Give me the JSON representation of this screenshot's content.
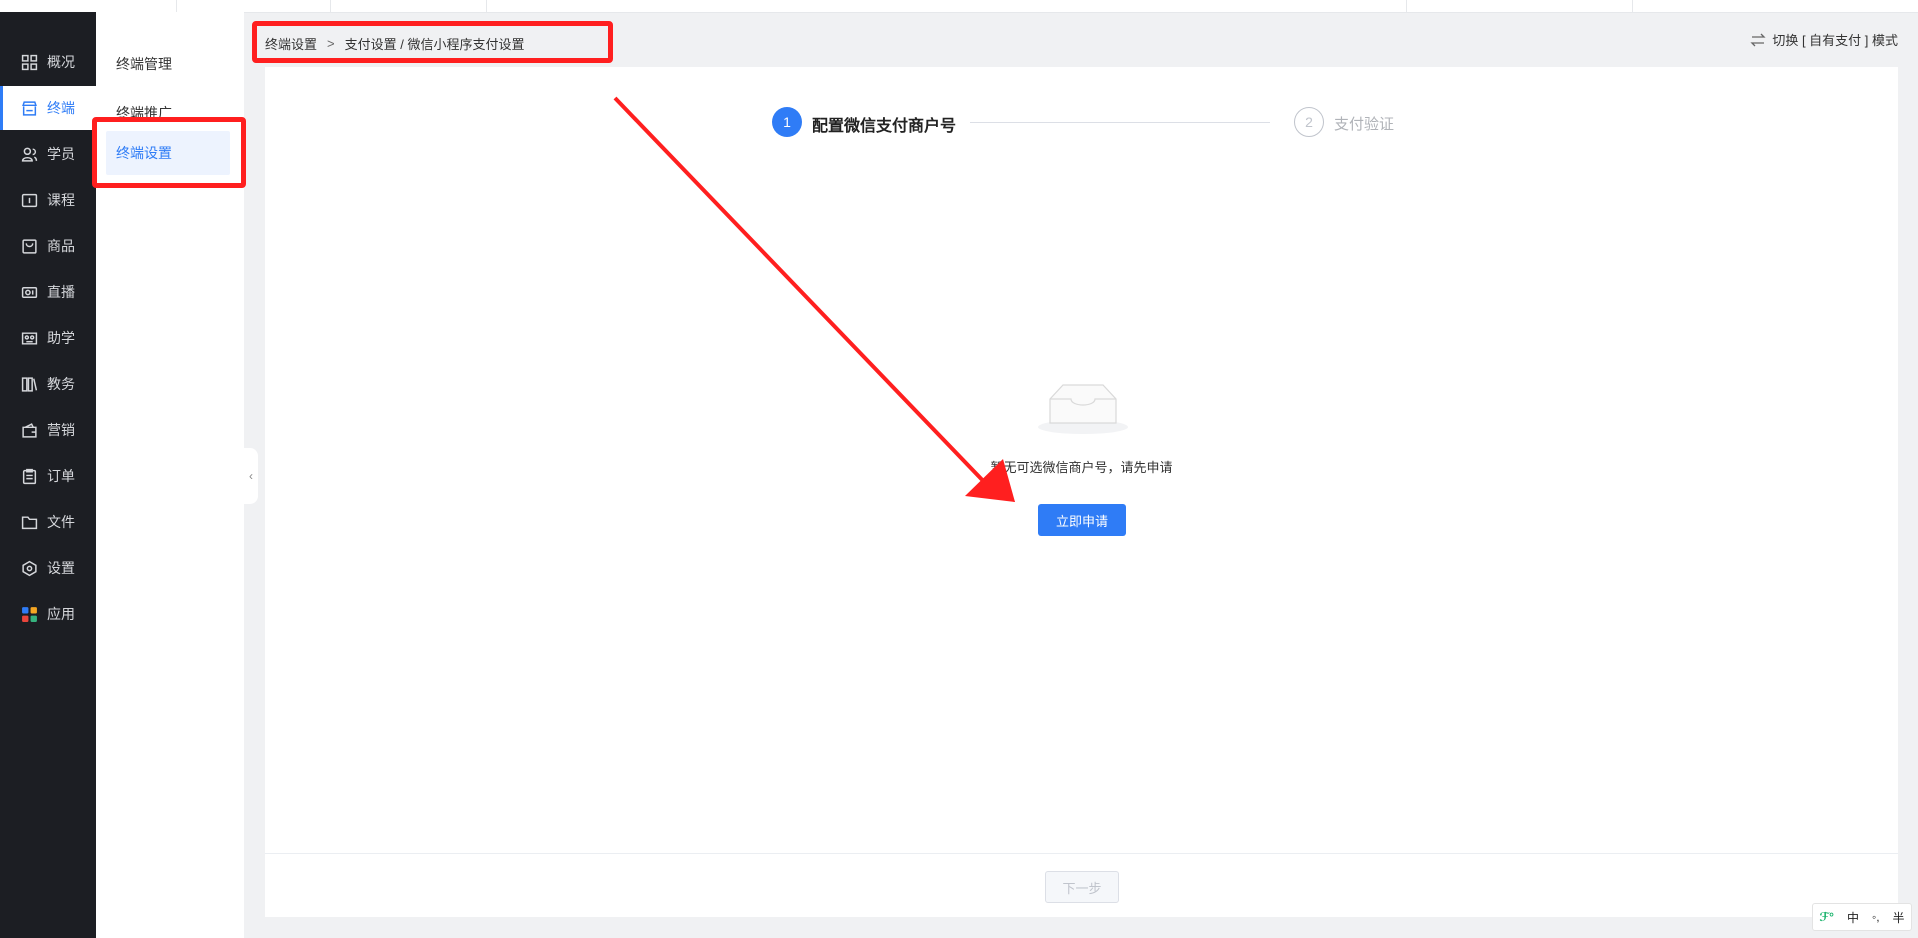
{
  "sidebar": {
    "items": [
      {
        "label": "概况",
        "icon": "grid-icon"
      },
      {
        "label": "终端",
        "icon": "store-icon"
      },
      {
        "label": "学员",
        "icon": "users-icon"
      },
      {
        "label": "课程",
        "icon": "course-icon"
      },
      {
        "label": "商品",
        "icon": "bag-icon"
      },
      {
        "label": "直播",
        "icon": "video-camera-icon"
      },
      {
        "label": "助学",
        "icon": "study-icon"
      },
      {
        "label": "教务",
        "icon": "books-icon"
      },
      {
        "label": "营销",
        "icon": "wallet-icon"
      },
      {
        "label": "订单",
        "icon": "clipboard-icon"
      },
      {
        "label": "文件",
        "icon": "folder-icon"
      },
      {
        "label": "设置",
        "icon": "hexagon-settings-icon"
      },
      {
        "label": "应用",
        "icon": "apps-icon"
      }
    ],
    "active_index": 1
  },
  "submenu": {
    "items": [
      {
        "label": "终端管理"
      },
      {
        "label": "终端推广"
      },
      {
        "label": "终端设置"
      }
    ],
    "active_index": 2
  },
  "breadcrumb": {
    "first": "终端设置",
    "separator": ">",
    "second": "支付设置 / 微信小程序支付设置"
  },
  "mode_switch": {
    "label": "切换 [ 自有支付 ] 模式",
    "icon": "swap-arrows-icon"
  },
  "steps": [
    {
      "number": "1",
      "label": "配置微信支付商户号",
      "state": "active"
    },
    {
      "number": "2",
      "label": "支付验证",
      "state": "pending"
    }
  ],
  "empty_state": {
    "icon": "empty-inbox-icon",
    "text": "暂无可选微信商户号，请先申请",
    "button": "立即申请"
  },
  "footer": {
    "next_button": "下一步"
  },
  "ime": {
    "logo": "ℱ°",
    "mode": "中",
    "punct": "◦,",
    "width": "半"
  },
  "colors": {
    "accent": "#2f7cf6",
    "sidebar_bg": "#1c1e23",
    "annotation": "#ff1f1f"
  }
}
